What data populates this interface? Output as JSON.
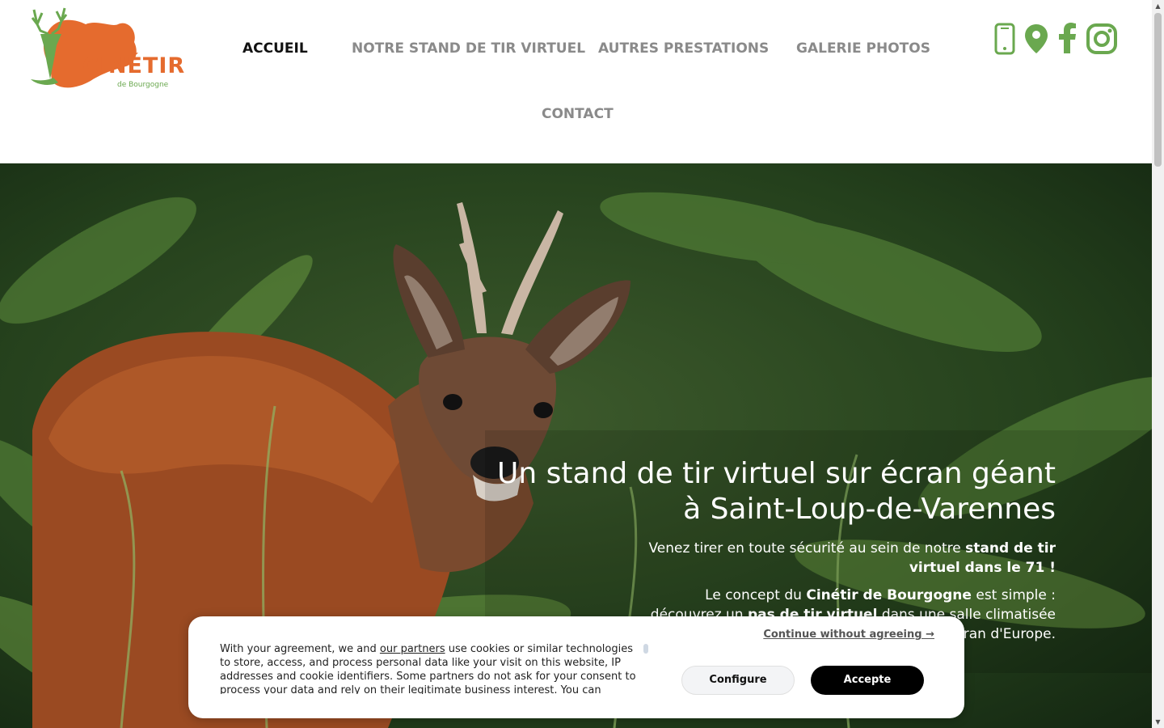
{
  "brand": {
    "name": "CINÉTIR",
    "subtitle": "de Bourgogne",
    "orange": "#e56b2e",
    "green": "#6aa84f"
  },
  "nav": {
    "items": [
      {
        "label": "ACCUEIL",
        "active": true
      },
      {
        "label": "NOTRE STAND DE TIR VIRTUEL",
        "active": false
      },
      {
        "label": "AUTRES PRESTATIONS",
        "active": false
      },
      {
        "label": "GALERIE PHOTOS",
        "active": false
      },
      {
        "label": "CONTACT",
        "active": false
      }
    ]
  },
  "social_icons": [
    "phone-icon",
    "map-pin-icon",
    "facebook-icon",
    "instagram-icon"
  ],
  "hero": {
    "title_line1": "Un stand de tir virtuel sur écran géant",
    "title_line2": "à Saint-Loup-de-Varennes",
    "p1_a": "Venez tirer en toute sécurité au sein de notre ",
    "p1_b": "stand de tir virtuel dans le 71 !",
    "p2_a": "Le concept du ",
    "p2_b": "Cinétir de Bourgogne",
    "p2_c": " est simple : découvrez un ",
    "p2_d": "pas de tir virtuel",
    "p2_e": " dans une salle climatisée et ",
    "p2_f": "grand écran",
    "p2_g": " d'Europe."
  },
  "cookie": {
    "continue_label": "Continue without agreeing →",
    "text_a": "With your agreement, we and ",
    "text_link": "our partners",
    "text_b": " use cookies or similar technologies to store, access, and process personal data like your visit on this website, IP addresses and cookie identifiers. Some partners do not ask for your consent to process your data and rely on their legitimate business interest. You can",
    "configure_label": "Configure",
    "accept_label": "Accepte"
  }
}
